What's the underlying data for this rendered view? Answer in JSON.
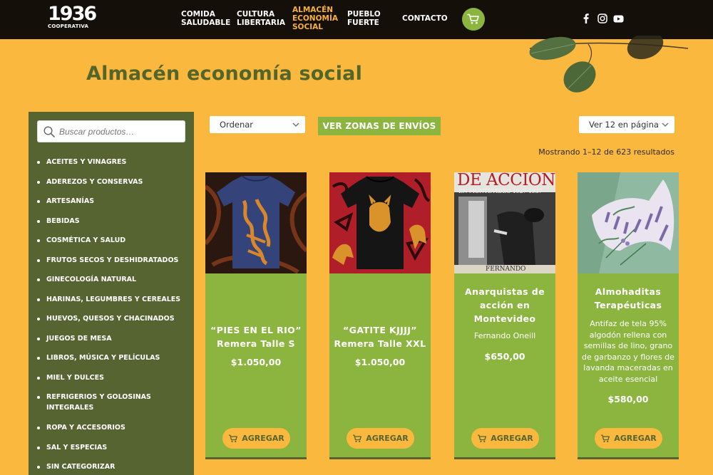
{
  "header": {
    "logo_main": "1936",
    "logo_sub": "COOPERATIVA",
    "nav": [
      {
        "line1": "COMIDA",
        "line2": "SALUDABLE",
        "line3": ""
      },
      {
        "line1": "CULTURA",
        "line2": "LIBERTARIA",
        "line3": ""
      },
      {
        "line1": "ALMACÉN",
        "line2": "ECONOMÍA",
        "line3": "SOCIAL"
      },
      {
        "line1": "PUEBLO",
        "line2": "FUERTE",
        "line3": ""
      },
      {
        "line1": "CONTACTO",
        "line2": "",
        "line3": ""
      }
    ],
    "active_nav": "ALMACÉN ECONOMÍA SOCIAL",
    "social_icons": [
      "facebook-icon",
      "instagram-icon",
      "youtube-icon"
    ]
  },
  "page": {
    "title": "Almacén economía social"
  },
  "sidebar": {
    "search_placeholder": "Buscar productos…",
    "categories": [
      "ACEITES Y VINAGRES",
      "ADEREZOS Y CONSERVAS",
      "ARTESANÍAS",
      "BEBIDAS",
      "COSMÉTICA Y SALUD",
      "FRUTOS SECOS Y DESHIDRATADOS",
      "GINECOLOGÍA NATURAL",
      "HARINAS, LEGUMBRES Y CEREALES",
      "HUEVOS, QUESOS Y CHACINADOS",
      "JUEGOS DE MESA",
      "LIBROS, MÚSICA Y PELÍCULAS",
      "MIEL Y DULCES",
      "REFRIGERIOS Y GOLOSINAS INTEGRALES",
      "ROPA Y ACCESORIOS",
      "SAL Y ESPECIAS",
      "SIN CATEGORIZAR"
    ]
  },
  "toolbar": {
    "sort_label": "Ordenar",
    "zones_button": "VER ZONAS DE ENVÍOS",
    "per_page_label": "Ver 12 en página",
    "results_text": "Mostrando 1–12 de 623 resultados"
  },
  "products": [
    {
      "name": "“PIES EN EL RIO” Remera Talle S",
      "desc": "",
      "price": "$1.050,00",
      "button": "AGREGAR"
    },
    {
      "name": "“GATITE KJJJJ” Remera Talle XXL",
      "desc": "",
      "price": "$1.050,00",
      "button": "AGREGAR"
    },
    {
      "name": "Anarquistas de acción en Montevideo",
      "desc": "Fernando Oneill",
      "price": "$650,00",
      "button": "AGREGAR"
    },
    {
      "name": "Almohaditas Terapéuticas",
      "desc": "Antifaz de tela 95% algodón rellena con semillas de lino, grano de garbanzo y flores de lavanda maceradas en aceite esencial",
      "price": "$580,00",
      "button": "AGREGAR"
    }
  ],
  "book_cover": {
    "title": "DE ACCION",
    "subtitle": "EN MONTEVIDEO 1927-1937",
    "author": "FERNANDO"
  },
  "colors": {
    "page_bg": "#fbb83e",
    "header_bg": "#150f0a",
    "sidebar_bg": "#556430",
    "card_green": "#8bb53e",
    "title_green": "#54652a",
    "accent_orange": "#f7b232"
  }
}
